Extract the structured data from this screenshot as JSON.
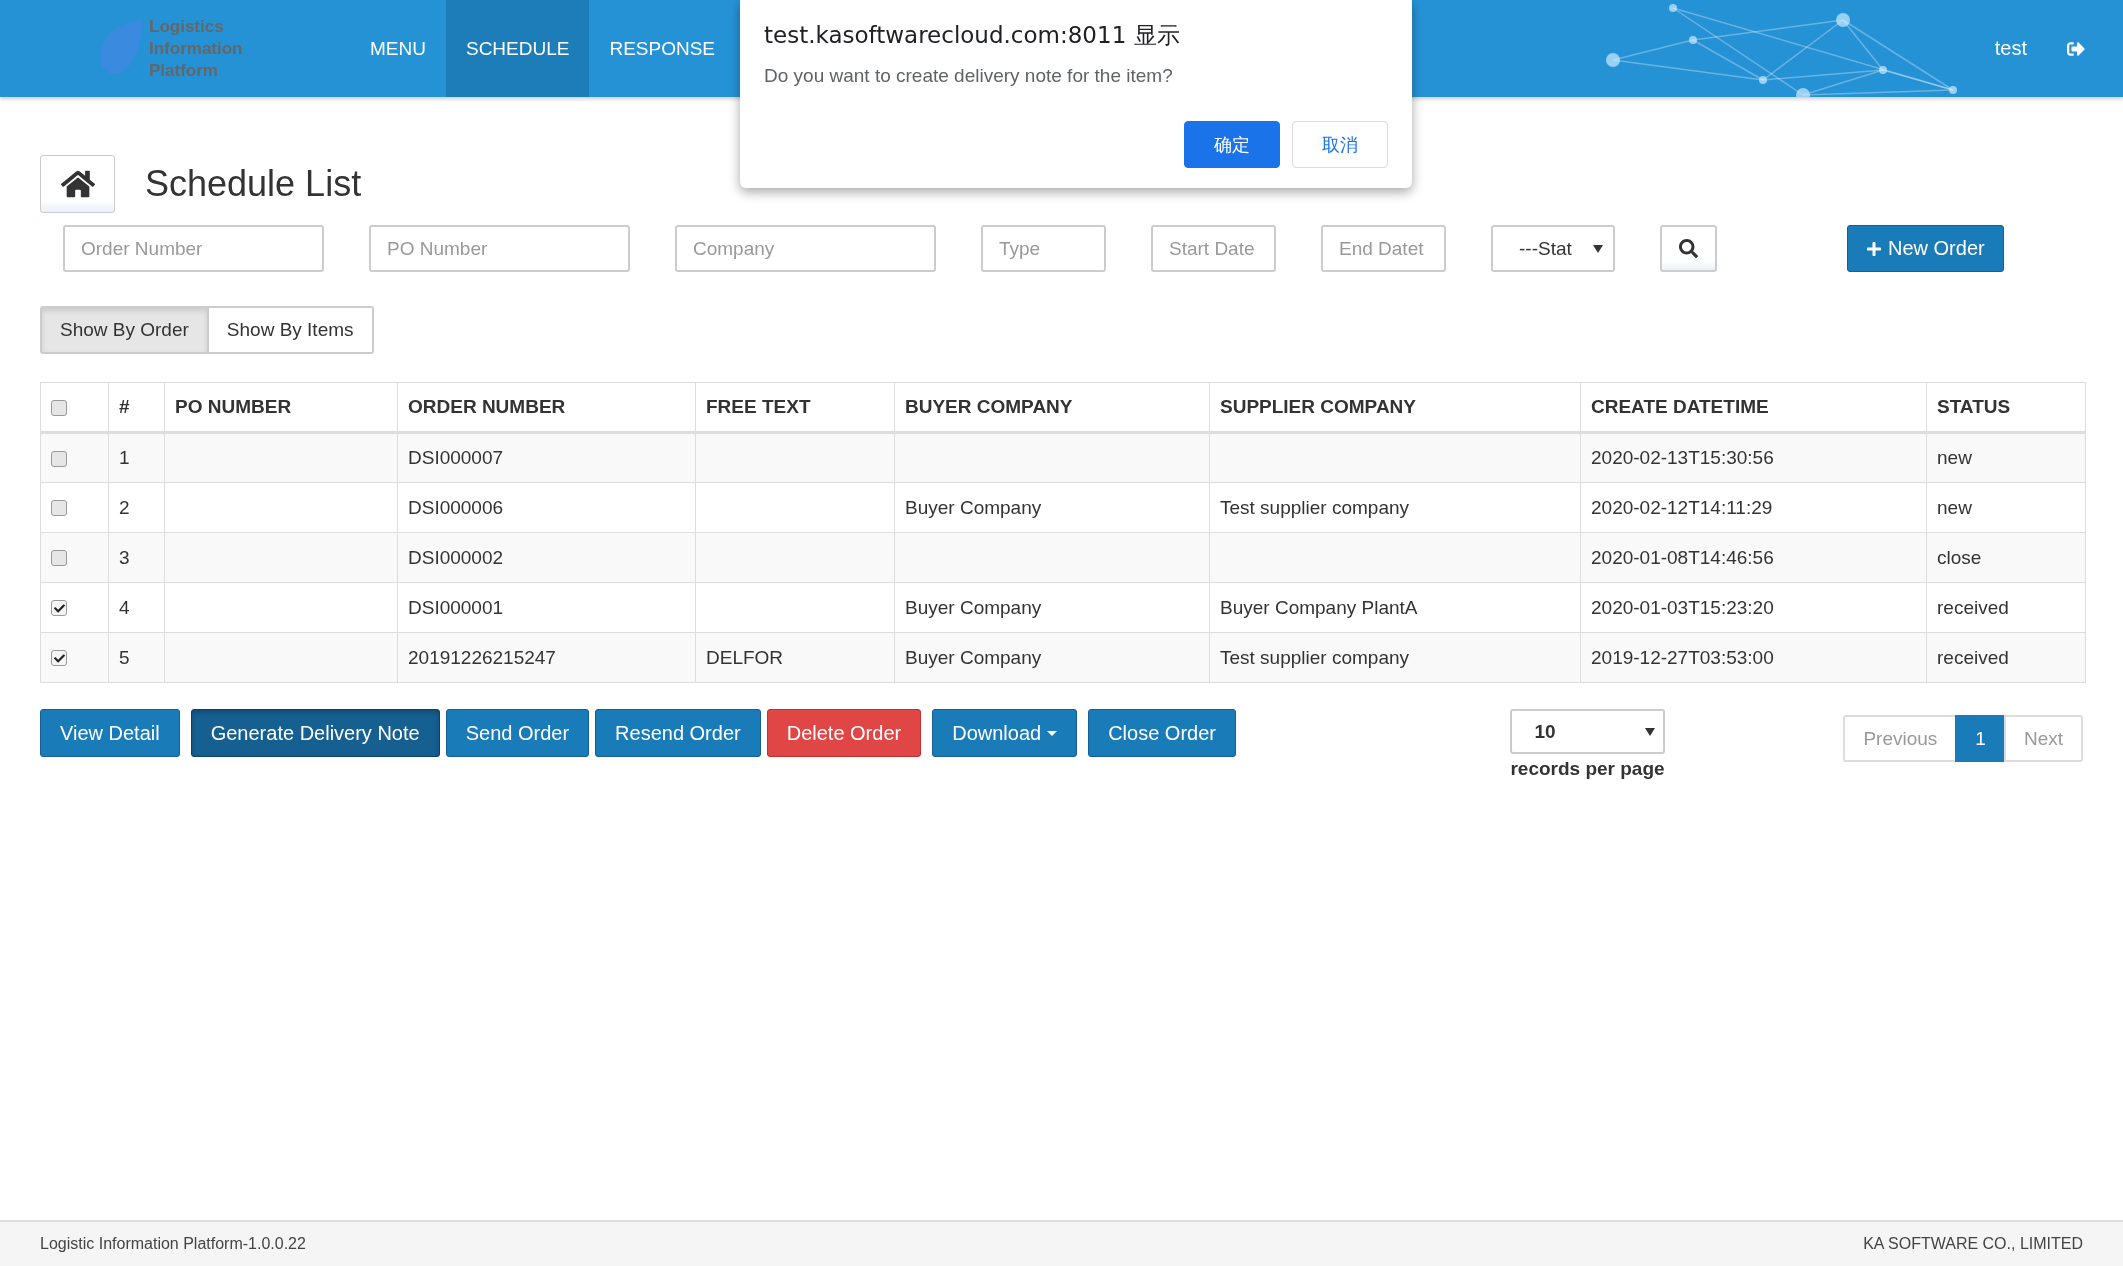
{
  "header": {
    "logo_lines": [
      "Logistics",
      "Information",
      "Platform"
    ],
    "nav": [
      {
        "label": "MENU",
        "selected": false
      },
      {
        "label": "SCHEDULE",
        "selected": true
      },
      {
        "label": "RESPONSE",
        "selected": false
      }
    ],
    "user": "test"
  },
  "dialog": {
    "title": "test.kasoftwarecloud.com:8011 显示",
    "message": "Do you want to create delivery note for the item?",
    "buttons": [
      {
        "label": "确定",
        "kind": "primary"
      },
      {
        "label": "取消",
        "kind": "secondary"
      }
    ]
  },
  "page": {
    "title": "Schedule List"
  },
  "filters": [
    {
      "placeholder": "Order Number",
      "kind": "wide"
    },
    {
      "placeholder": "PO Number",
      "kind": "wide"
    },
    {
      "placeholder": "Company",
      "kind": "wide"
    },
    {
      "placeholder": "Type",
      "kind": "narrow"
    },
    {
      "placeholder": "Start Date",
      "kind": "narrow"
    },
    {
      "placeholder": "End Datet",
      "kind": "narrow"
    }
  ],
  "status_select": {
    "value": "---Stat"
  },
  "new_order": "New Order",
  "view_toggle": [
    {
      "label": "Show By Order",
      "selected": true
    },
    {
      "label": "Show By Items",
      "selected": false
    }
  ],
  "table": {
    "header_checked": false,
    "columns": [
      "#",
      "PO NUMBER",
      "ORDER NUMBER",
      "FREE TEXT",
      "BUYER COMPANY",
      "SUPPLIER COMPANY",
      "CREATE DATETIME",
      "STATUS"
    ],
    "rows": [
      {
        "checked": false,
        "cells": [
          "1",
          "",
          "DSI000007",
          "",
          "",
          "",
          "2020-02-13T15:30:56",
          "new"
        ]
      },
      {
        "checked": false,
        "cells": [
          "2",
          "",
          "DSI000006",
          "",
          "Buyer Company",
          "Test supplier company",
          "2020-02-12T14:11:29",
          "new"
        ]
      },
      {
        "checked": false,
        "cells": [
          "3",
          "",
          "DSI000002",
          "",
          "",
          "",
          "2020-01-08T14:46:56",
          "close"
        ]
      },
      {
        "checked": true,
        "cells": [
          "4",
          "",
          "DSI000001",
          "",
          "Buyer Company",
          "Buyer Company PlantA",
          "2020-01-03T15:23:20",
          "received"
        ]
      },
      {
        "checked": true,
        "cells": [
          "5",
          "",
          "20191226215247",
          "DELFOR",
          "Buyer Company",
          "Test supplier company",
          "2019-12-27T03:53:00",
          "received"
        ]
      }
    ]
  },
  "actions": [
    {
      "label": "View Detail",
      "kind": "primary"
    },
    {
      "label": "Generate Delivery Note",
      "kind": "active"
    },
    {
      "label": "Send Order",
      "kind": "primary"
    },
    {
      "label": "Resend Order",
      "kind": "primary"
    },
    {
      "label": "Delete Order",
      "kind": "danger"
    },
    {
      "label": "Download",
      "kind": "dropdown"
    },
    {
      "label": "Close Order",
      "kind": "primary"
    }
  ],
  "page_size": {
    "value": "10",
    "label": "records per page"
  },
  "pagination": [
    {
      "label": "Previous",
      "selected": false
    },
    {
      "label": "1",
      "selected": true
    },
    {
      "label": "Next",
      "selected": false
    }
  ],
  "footer": {
    "left": "Logistic Information Platform-1.0.0.22",
    "right": "KA SOFTWARE CO., LIMITED"
  }
}
